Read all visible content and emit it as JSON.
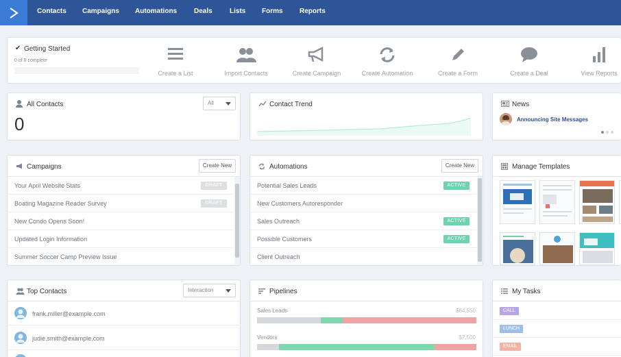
{
  "nav": {
    "items": [
      "Contacts",
      "Campaigns",
      "Automations",
      "Deals",
      "Lists",
      "Forms",
      "Reports"
    ]
  },
  "getting_started": {
    "title": "Getting Started",
    "progress_text": "0 of 9 complete",
    "progress": 0,
    "actions": [
      "Create a List",
      "Import Contacts",
      "Create Campaign",
      "Create Automation",
      "Create a Form",
      "Create a Deal",
      "View Reports"
    ]
  },
  "all_contacts": {
    "title": "All Contacts",
    "filter": "All",
    "count": "0"
  },
  "contact_trend": {
    "title": "Contact Trend"
  },
  "news": {
    "title": "News",
    "item": "Announcing Site Messages"
  },
  "campaigns": {
    "title": "Campaigns",
    "create_label": "Create New",
    "items": [
      {
        "name": "Your April Website Stats",
        "status": "DRAFT"
      },
      {
        "name": "Boating Magazine Reader Survey",
        "status": "DRAFT"
      },
      {
        "name": "New Condo Opens Soon!",
        "status": ""
      },
      {
        "name": "Updated Login Information",
        "status": ""
      },
      {
        "name": "Summer Soccer Camp Preview Issue",
        "status": ""
      }
    ]
  },
  "automations": {
    "title": "Automations",
    "create_label": "Create New",
    "items": [
      {
        "name": "Potential Sales Leads",
        "status": "ACTIVE"
      },
      {
        "name": "New Customers Autoresponder",
        "status": ""
      },
      {
        "name": "Sales Outreach",
        "status": "ACTIVE"
      },
      {
        "name": "Possible Customers",
        "status": "ACTIVE"
      },
      {
        "name": "Client Outreach",
        "status": ""
      }
    ]
  },
  "templates": {
    "title": "Manage Templates"
  },
  "top_contacts": {
    "title": "Top Contacts",
    "sort": "Interaction",
    "items": [
      "frank.miller@example.com",
      "judie.smith@example.com"
    ]
  },
  "pipelines": {
    "title": "Pipelines",
    "items": [
      {
        "name": "Sales Leads",
        "value": "$64,550",
        "segments": [
          0.29,
          0.1,
          0.61
        ],
        "colors": [
          "#d6d9dc",
          "#7fd8b0",
          "#f0a3a3"
        ]
      },
      {
        "name": "Vendors",
        "value": "$7,500",
        "segments": [
          0.1,
          0.71,
          0.19
        ],
        "colors": [
          "#d6d9dc",
          "#7fd8b0",
          "#f0a3a3"
        ]
      }
    ]
  },
  "tasks": {
    "title": "My Tasks",
    "items": [
      {
        "label": "CALL",
        "color": "#b7a7ea"
      },
      {
        "label": "LUNCH",
        "color": "#9fbfe9"
      },
      {
        "label": "EMAIL",
        "color": "#f2b3a2"
      }
    ]
  },
  "colors": {
    "nav_bg": "#2e5597",
    "logo_bg": "#3a7bd5",
    "active": "#6fd3ad",
    "link": "#2a4f8a"
  }
}
